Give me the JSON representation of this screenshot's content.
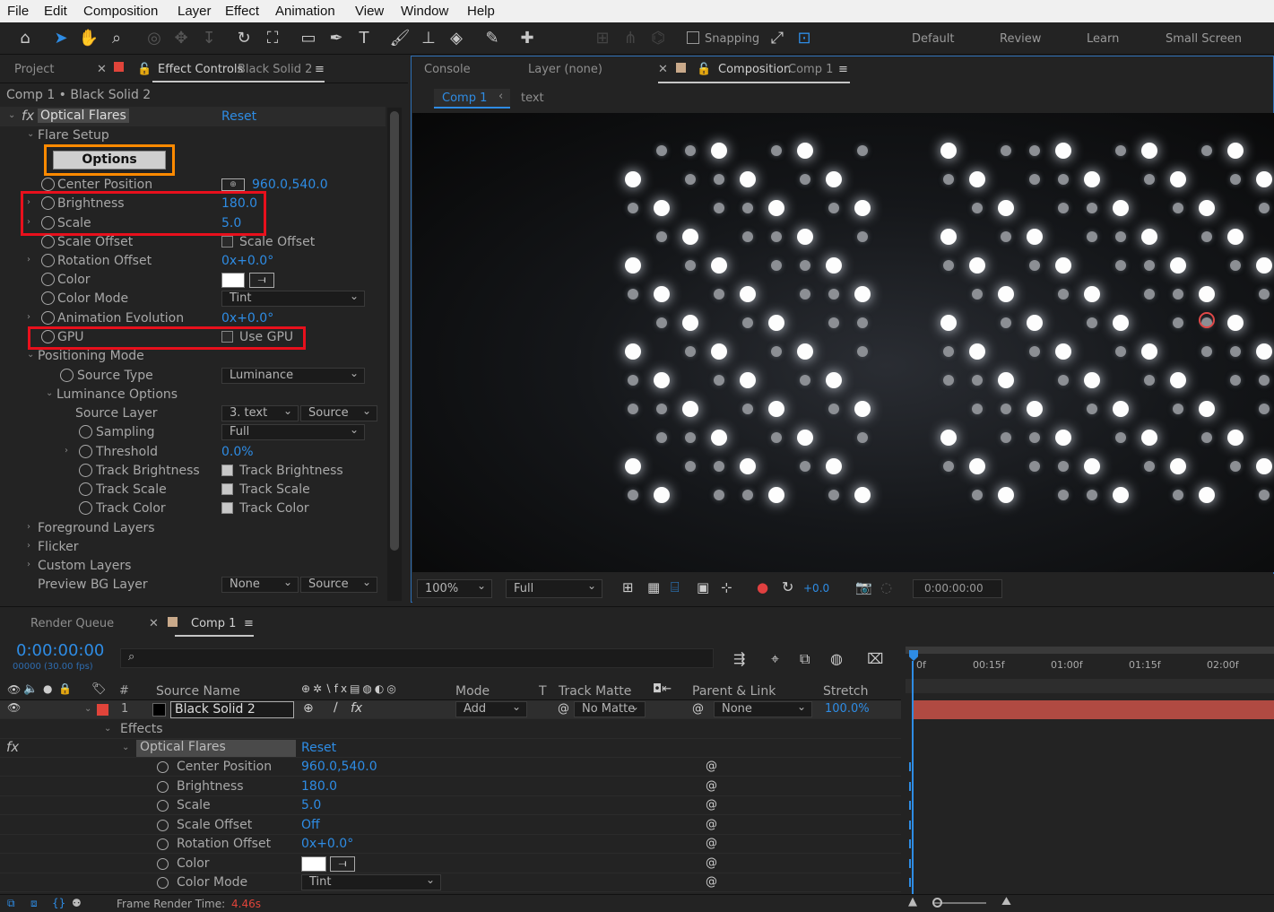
{
  "menu": [
    "File",
    "Edit",
    "Composition",
    "Layer",
    "Effect",
    "Animation",
    "View",
    "Window",
    "Help"
  ],
  "toolbar": {
    "snapping": "Snapping",
    "workspaces": [
      "Default",
      "Review",
      "Learn",
      "Small Screen"
    ]
  },
  "left_panel": {
    "tab_project": "Project",
    "tab_effect_controls": "Effect Controls",
    "tab_effect_layer": "Black Solid 2",
    "breadcrumb": "Comp 1 • Black Solid 2",
    "effect_name": "Optical Flares",
    "reset": "Reset",
    "flare_setup": "Flare Setup",
    "options_button": "Options",
    "props": [
      {
        "label": "Center Position",
        "value": "960.0,540.0"
      },
      {
        "label": "Brightness",
        "value": "180.0"
      },
      {
        "label": "Scale",
        "value": "5.0"
      },
      {
        "label": "Scale Offset",
        "value": "Scale Offset"
      },
      {
        "label": "Rotation Offset",
        "value": "0x+0.0°"
      },
      {
        "label": "Color",
        "value": ""
      },
      {
        "label": "Color Mode",
        "value": "Tint"
      },
      {
        "label": "Animation Evolution",
        "value": "0x+0.0°"
      },
      {
        "label": "GPU",
        "value": "Use GPU"
      }
    ],
    "positioning_mode": "Positioning Mode",
    "source_type_label": "Source Type",
    "source_type_value": "Luminance",
    "luminance_options": "Luminance Options",
    "source_layer_label": "Source Layer",
    "source_layer_value": "3. text",
    "source_layer_source": "Source",
    "sampling_label": "Sampling",
    "sampling_value": "Full",
    "threshold_label": "Threshold",
    "threshold_value": "0.0%",
    "track_brightness_label": "Track Brightness",
    "track_scale_label": "Track Scale",
    "track_color_label": "Track Color",
    "foreground_layers": "Foreground Layers",
    "flicker": "Flicker",
    "custom_layers": "Custom Layers",
    "preview_bg_label": "Preview BG Layer",
    "preview_bg_value": "None",
    "preview_bg_source": "Source"
  },
  "comp_panel": {
    "tab_console": "Console",
    "tab_layer": "Layer (none)",
    "tab_composition": "Composition",
    "tab_comp_name": "Comp 1",
    "crumb_comp": "Comp 1",
    "crumb_text": "text",
    "zoom": "100%",
    "resolution": "Full",
    "exposure": "+0.0",
    "timecode": "0:00:00:00"
  },
  "timeline": {
    "tab_render_queue": "Render Queue",
    "tab_comp": "Comp 1",
    "timecode": "0:00:00:00",
    "frames": "00000 (30.00 fps)",
    "search_placeholder": "",
    "cols": {
      "num": "#",
      "source_name": "Source Name",
      "mode": "Mode",
      "t": "T",
      "track_matte": "Track Matte",
      "parent": "Parent & Link",
      "stretch": "Stretch"
    },
    "layer": {
      "num": "1",
      "name": "Black Solid 2",
      "mode": "Add",
      "matte": "No Matte",
      "parent": "None",
      "stretch": "100.0%"
    },
    "effects_label": "Effects",
    "effect_name": "Optical Flares",
    "reset": "Reset",
    "props": [
      {
        "label": "Center Position",
        "value": "960.0,540.0"
      },
      {
        "label": "Brightness",
        "value": "180.0"
      },
      {
        "label": "Scale",
        "value": "5.0"
      },
      {
        "label": "Scale Offset",
        "value": "Off"
      },
      {
        "label": "Rotation Offset",
        "value": "0x+0.0°"
      },
      {
        "label": "Color",
        "value": ""
      },
      {
        "label": "Color Mode",
        "value": "Tint"
      }
    ],
    "ruler": [
      "0f",
      "00:15f",
      "01:00f",
      "01:15f",
      "02:00f"
    ],
    "frame_render_label": "Frame Render Time:",
    "frame_render_value": "4.46s"
  }
}
